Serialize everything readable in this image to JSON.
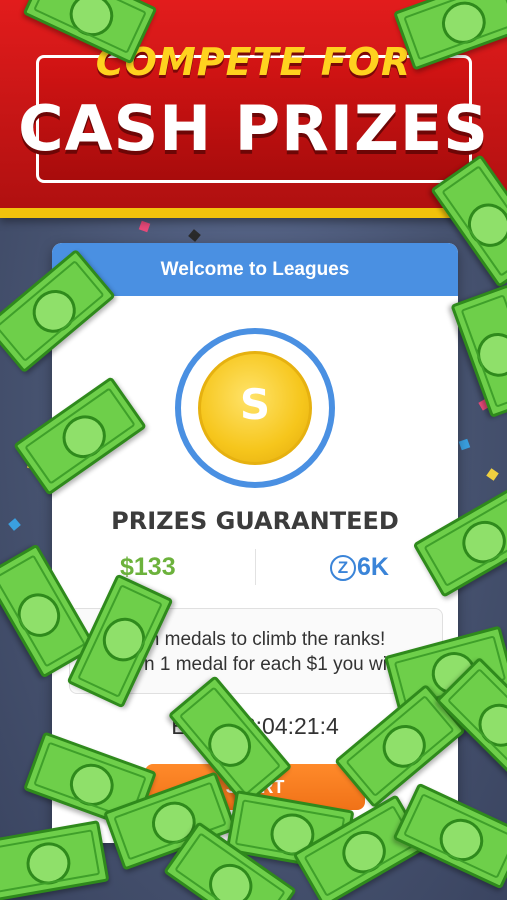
{
  "banner": {
    "headline_top": "COMPETE FOR",
    "headline_main": "CASH PRIZES"
  },
  "card": {
    "header_title": "Welcome to Leagues",
    "medal_glyph": "S",
    "prizes_title": "PRIZES GUARANTEED",
    "cash_prize": "$133",
    "coin_prize": "6K",
    "coin_icon_letter": "Z",
    "info_line_1": "Win medals to climb the ranks!",
    "info_line_2": "Earn 1 medal for each $1 you win",
    "ends_text": "Ends 02:04:21:4",
    "start_label": "START"
  },
  "colors": {
    "banner_red": "#d41414",
    "banner_gold": "#f2c20c",
    "header_blue": "#4a90e2",
    "cash_green": "#6cb23c",
    "coin_blue": "#3a84d8",
    "button_orange": "#f07218",
    "bill_green": "#6ecf4a"
  },
  "icons": [
    "medal-icon",
    "coin-z-icon",
    "dollar-bill-icon"
  ]
}
